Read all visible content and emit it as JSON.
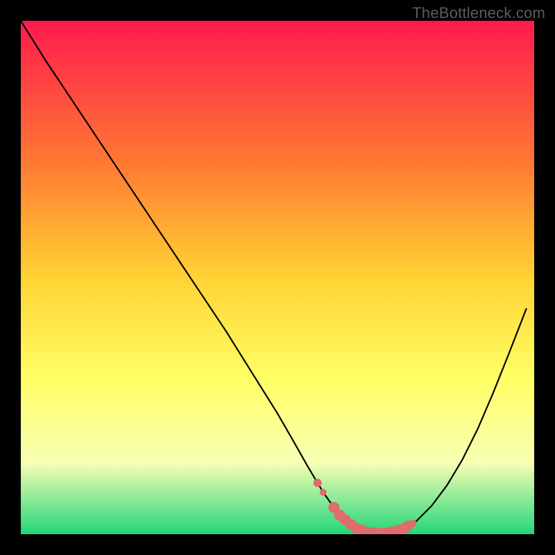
{
  "watermark": "TheBottleneck.com",
  "colors": {
    "frame": "#000000",
    "grad_top": "#ff1a4d",
    "grad_mid1": "#ff7a33",
    "grad_mid2": "#ffd333",
    "grad_mid3": "#ffff66",
    "grad_low": "#f8ffb3",
    "grad_bottom": "#23d67a",
    "curve": "#000000",
    "highlight": "#e06c6c"
  },
  "chart_data": {
    "type": "line",
    "title": "",
    "xlabel": "",
    "ylabel": "",
    "xlim": [
      0,
      100
    ],
    "ylim": [
      0,
      100
    ],
    "series": [
      {
        "name": "bottleneck-curve",
        "x": [
          0,
          5,
          10,
          15,
          20,
          25,
          30,
          35,
          40,
          45,
          50,
          53,
          56,
          59,
          62,
          65,
          68,
          71,
          74,
          77,
          80,
          83,
          86,
          89,
          92,
          95,
          98.5
        ],
        "values": [
          100,
          92,
          84.5,
          77,
          69.5,
          62,
          54.5,
          47,
          39.5,
          31.5,
          23.5,
          18.3,
          13,
          8,
          3.8,
          1.3,
          0.2,
          0.2,
          0.8,
          2.5,
          5.5,
          9.5,
          14.5,
          20.5,
          27.5,
          35,
          44
        ]
      }
    ],
    "highlight_segment": {
      "name": "optimal-region",
      "x_range": [
        57.5,
        75.5
      ],
      "note": "pink dotted/blob band near curve minimum"
    }
  }
}
